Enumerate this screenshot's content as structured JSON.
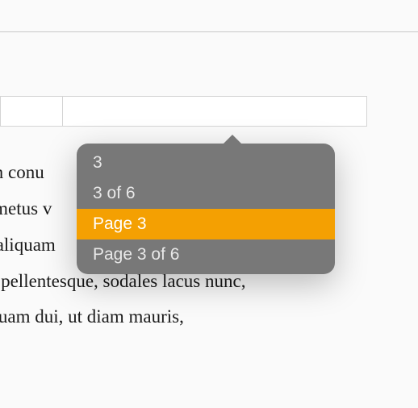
{
  "toolbar": {
    "field_left_value": "",
    "field_right_value": ""
  },
  "document": {
    "line1": "im conu",
    "line2": "t metus v",
    "line3": "s aliquam",
    "line4": "is pellentesque, sodales lacus nunc,",
    "line5": "iquam dui, ut diam mauris,"
  },
  "popover": {
    "options": [
      {
        "label": "3",
        "selected": false
      },
      {
        "label": "3 of 6",
        "selected": false
      },
      {
        "label": "Page 3",
        "selected": true
      },
      {
        "label": "Page 3 of 6",
        "selected": false
      }
    ]
  }
}
